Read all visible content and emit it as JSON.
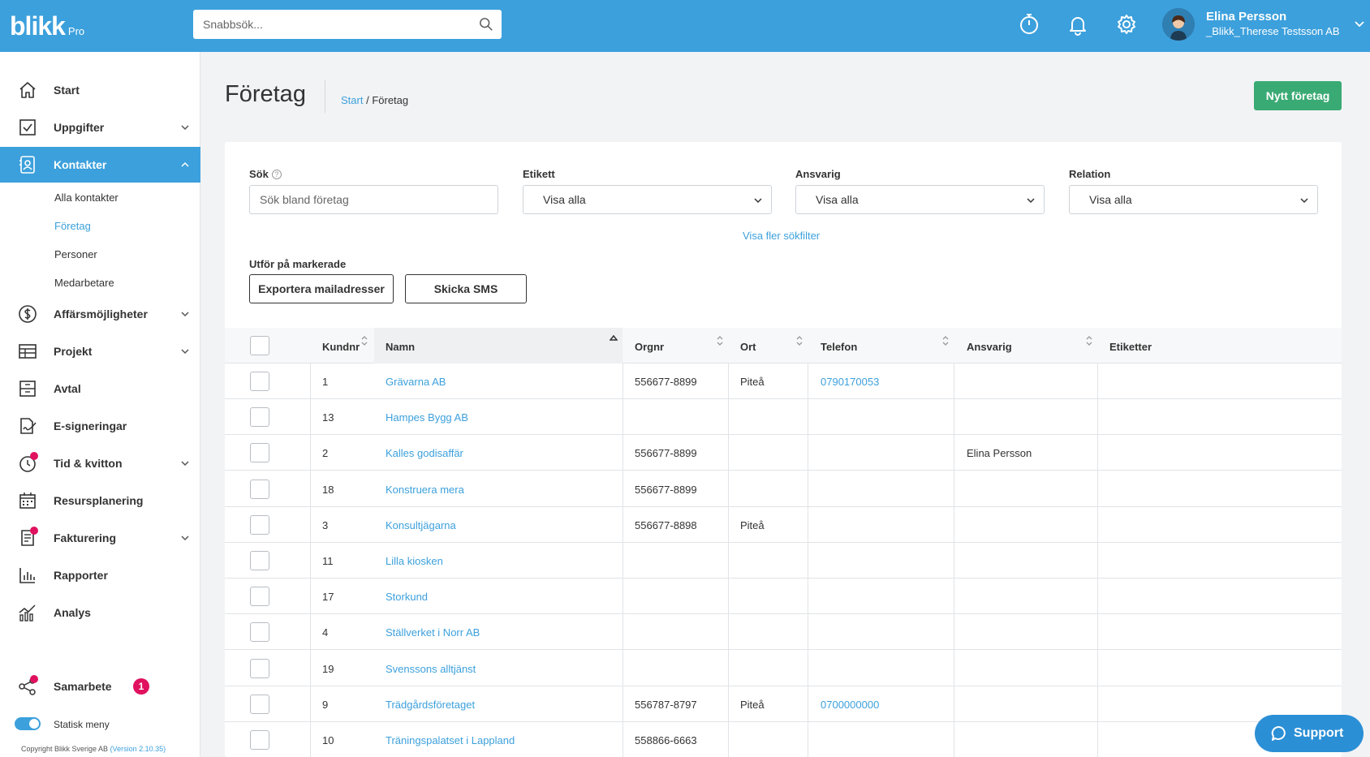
{
  "header": {
    "logo_brand": "blikk",
    "logo_suffix": "Pro",
    "search_placeholder": "Snabbsök...",
    "user_name": "Elina Persson",
    "user_company": "_Blikk_Therese Testsson AB"
  },
  "sidebar": {
    "items": [
      {
        "label": "Start",
        "icon": "home-icon"
      },
      {
        "label": "Uppgifter",
        "icon": "checkbox-icon"
      },
      {
        "label": "Kontakter",
        "icon": "contacts-icon"
      },
      {
        "label": "Affärsmöjligheter",
        "icon": "dollar-icon"
      },
      {
        "label": "Projekt",
        "icon": "table-icon"
      },
      {
        "label": "Avtal",
        "icon": "archive-icon"
      },
      {
        "label": "E-signeringar",
        "icon": "signature-icon"
      },
      {
        "label": "Tid & kvitton",
        "icon": "clock-icon"
      },
      {
        "label": "Resursplanering",
        "icon": "calendar-icon"
      },
      {
        "label": "Fakturering",
        "icon": "invoice-icon"
      },
      {
        "label": "Rapporter",
        "icon": "bar-chart-icon"
      },
      {
        "label": "Analys",
        "icon": "analytics-icon"
      }
    ],
    "sub_items": [
      "Alla kontakter",
      "Företag",
      "Personer",
      "Medarbetare"
    ],
    "collab_label": "Samarbete",
    "collab_count": "1",
    "toggle_label": "Statisk meny",
    "copyright": "Copyright Blikk Sverige AB",
    "version": "(Version 2.10.35)"
  },
  "page": {
    "title": "Företag",
    "breadcrumb_root": "Start",
    "breadcrumb_sep": " / ",
    "breadcrumb_current": "Företag",
    "new_button": "Nytt företag"
  },
  "filters": {
    "search_label": "Sök",
    "search_placeholder": "Sök bland företag",
    "tag_label": "Etikett",
    "tag_value": "Visa alla",
    "owner_label": "Ansvarig",
    "owner_value": "Visa alla",
    "relation_label": "Relation",
    "relation_value": "Visa alla",
    "more_filters": "Visa fler sökfilter",
    "bulk_label": "Utför på markerade",
    "export_button": "Exportera mailadresser",
    "sms_button": "Skicka SMS"
  },
  "table": {
    "columns": [
      "Kundnr",
      "Namn",
      "Orgnr",
      "Ort",
      "Telefon",
      "Ansvarig",
      "Etiketter"
    ],
    "rows": [
      {
        "kundnr": "1",
        "namn": "Grävarna AB",
        "orgnr": "556677-8899",
        "ort": "Piteå",
        "telefon": "0790170053",
        "ansvarig": "",
        "etiketter": ""
      },
      {
        "kundnr": "13",
        "namn": "Hampes Bygg AB",
        "orgnr": "",
        "ort": "",
        "telefon": "",
        "ansvarig": "",
        "etiketter": ""
      },
      {
        "kundnr": "2",
        "namn": "Kalles godisaffär",
        "orgnr": "556677-8899",
        "ort": "",
        "telefon": "",
        "ansvarig": "Elina Persson",
        "etiketter": ""
      },
      {
        "kundnr": "18",
        "namn": "Konstruera mera",
        "orgnr": "556677-8899",
        "ort": "",
        "telefon": "",
        "ansvarig": "",
        "etiketter": ""
      },
      {
        "kundnr": "3",
        "namn": "Konsultjägarna",
        "orgnr": "556677-8898",
        "ort": "Piteå",
        "telefon": "",
        "ansvarig": "",
        "etiketter": ""
      },
      {
        "kundnr": "11",
        "namn": "Lilla kiosken",
        "orgnr": "",
        "ort": "",
        "telefon": "",
        "ansvarig": "",
        "etiketter": ""
      },
      {
        "kundnr": "17",
        "namn": "Storkund",
        "orgnr": "",
        "ort": "",
        "telefon": "",
        "ansvarig": "",
        "etiketter": ""
      },
      {
        "kundnr": "4",
        "namn": "Ställverket i Norr AB",
        "orgnr": "",
        "ort": "",
        "telefon": "",
        "ansvarig": "",
        "etiketter": ""
      },
      {
        "kundnr": "19",
        "namn": "Svenssons alltjänst",
        "orgnr": "",
        "ort": "",
        "telefon": "",
        "ansvarig": "",
        "etiketter": ""
      },
      {
        "kundnr": "9",
        "namn": "Trädgårdsföretaget",
        "orgnr": "556787-8797",
        "ort": "Piteå",
        "telefon": "0700000000",
        "ansvarig": "",
        "etiketter": ""
      },
      {
        "kundnr": "10",
        "namn": "Träningspalatset i Lappland",
        "orgnr": "558866-6663",
        "ort": "",
        "telefon": "",
        "ansvarig": "",
        "etiketter": ""
      }
    ]
  },
  "support_label": "Support",
  "colors": {
    "primary": "#3ca0dc",
    "success": "#3aaa74",
    "badge": "#e0115f"
  }
}
